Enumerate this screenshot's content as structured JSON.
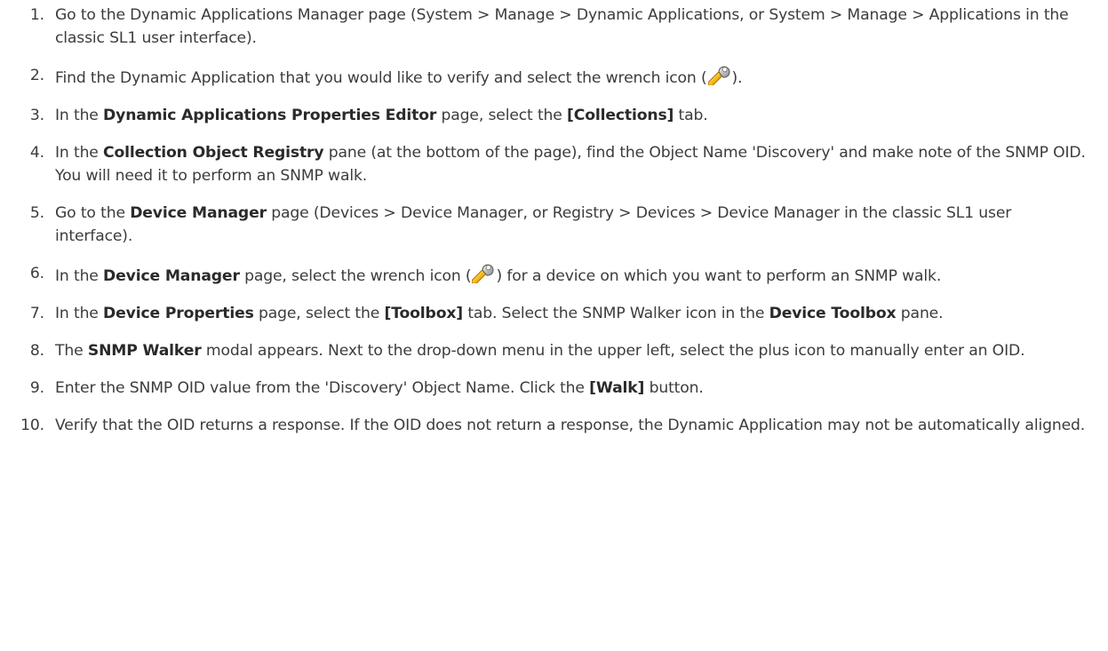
{
  "steps": [
    {
      "number": "1.",
      "parts": [
        {
          "t": "Go to the Dynamic Applications Manager page (System > Manage > Dynamic Applications, or System > Manage > Applications in the classic SL1 user interface)."
        }
      ]
    },
    {
      "number": "2.",
      "parts": [
        {
          "t": "Find the Dynamic Application that you would like to verify and select the wrench icon ("
        },
        {
          "icon": "wrench-icon"
        },
        {
          "t": ")."
        }
      ]
    },
    {
      "number": "3.",
      "parts": [
        {
          "t": "In the "
        },
        {
          "b": "Dynamic Applications Properties Editor"
        },
        {
          "t": " page, select the "
        },
        {
          "b": "[Collections]"
        },
        {
          "t": " tab."
        }
      ]
    },
    {
      "number": "4.",
      "parts": [
        {
          "t": "In the "
        },
        {
          "b": "Collection Object Registry"
        },
        {
          "t": " pane (at the bottom of the page), find the Object Name 'Discovery' and make note of the SNMP OID. You will need it to perform an SNMP walk."
        }
      ]
    },
    {
      "number": "5.",
      "parts": [
        {
          "t": "Go to the "
        },
        {
          "b": "Device Manager"
        },
        {
          "t": " page (Devices > Device Manager, or Registry > Devices > Device Manager in the classic SL1 user interface)."
        }
      ]
    },
    {
      "number": "6.",
      "parts": [
        {
          "t": "In the "
        },
        {
          "b": "Device Manager"
        },
        {
          "t": " page, select the wrench icon ("
        },
        {
          "icon": "wrench-icon"
        },
        {
          "t": ") for a device on which you want to perform an SNMP walk."
        }
      ]
    },
    {
      "number": "7.",
      "parts": [
        {
          "t": "In the "
        },
        {
          "b": "Device Properties"
        },
        {
          "t": " page, select the "
        },
        {
          "b": "[Toolbox]"
        },
        {
          "t": " tab. Select the SNMP Walker icon in the "
        },
        {
          "b": "Device Toolbox"
        },
        {
          "t": " pane."
        }
      ]
    },
    {
      "number": "8.",
      "parts": [
        {
          "t": "The "
        },
        {
          "b": "SNMP Walker"
        },
        {
          "t": " modal appears. Next to the drop-down menu in the upper left, select the plus icon to manually enter an OID."
        }
      ]
    },
    {
      "number": "9.",
      "parts": [
        {
          "t": "Enter the SNMP OID value from the 'Discovery' Object Name. Click the "
        },
        {
          "b": "[Walk]"
        },
        {
          "t": " button."
        }
      ]
    },
    {
      "number": "10.",
      "parts": [
        {
          "t": "Verify that the OID returns a response. If the OID does not return a response, the Dynamic Application may not be automatically aligned."
        }
      ]
    }
  ]
}
